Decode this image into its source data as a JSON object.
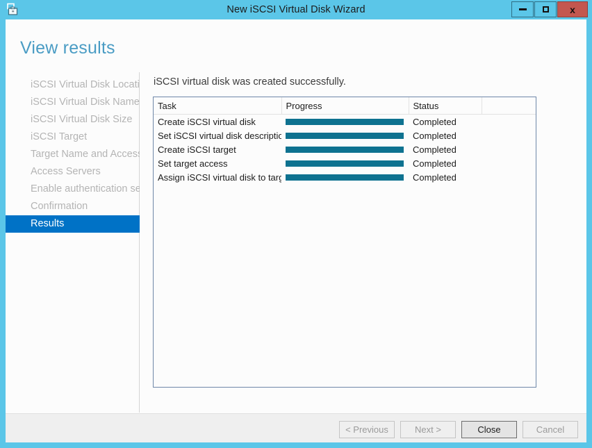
{
  "window": {
    "title": "New iSCSI Virtual Disk Wizard",
    "app_icon": "wizard-disk-icon",
    "titlebar_color": "#5bc6e8",
    "controls": {
      "minimize_label": "minimize-icon",
      "maximize_label": "maximize-icon",
      "close_label": "x"
    }
  },
  "page": {
    "heading": "View results",
    "heading_color": "#4a9cc4"
  },
  "sidebar": {
    "items": [
      {
        "label": "iSCSI Virtual Disk Location",
        "active": false
      },
      {
        "label": "iSCSI Virtual Disk Name",
        "active": false
      },
      {
        "label": "iSCSI Virtual Disk Size",
        "active": false
      },
      {
        "label": "iSCSI Target",
        "active": false
      },
      {
        "label": "Target Name and Access",
        "active": false
      },
      {
        "label": "Access Servers",
        "active": false
      },
      {
        "label": "Enable authentication ser...",
        "active": false
      },
      {
        "label": "Confirmation",
        "active": false
      },
      {
        "label": "Results",
        "active": true
      }
    ],
    "active_color": "#0072c6",
    "inactive_color": "#b4b4b4"
  },
  "main": {
    "message": "iSCSI virtual disk was created successfully.",
    "table": {
      "columns": [
        "Task",
        "Progress",
        "Status",
        ""
      ],
      "rows": [
        {
          "task": "Create iSCSI virtual disk",
          "progress": 100,
          "status": "Completed"
        },
        {
          "task": "Set iSCSI virtual disk description",
          "progress": 100,
          "status": "Completed"
        },
        {
          "task": "Create iSCSI target",
          "progress": 100,
          "status": "Completed"
        },
        {
          "task": "Set target access",
          "progress": 100,
          "status": "Completed"
        },
        {
          "task": "Assign iSCSI virtual disk to target",
          "progress": 100,
          "status": "Completed"
        }
      ],
      "progress_color": "#0e7290"
    }
  },
  "footer": {
    "buttons": [
      {
        "label": "< Previous",
        "enabled": false
      },
      {
        "label": "Next >",
        "enabled": false
      },
      {
        "label": "Close",
        "enabled": true
      },
      {
        "label": "Cancel",
        "enabled": false
      }
    ]
  }
}
